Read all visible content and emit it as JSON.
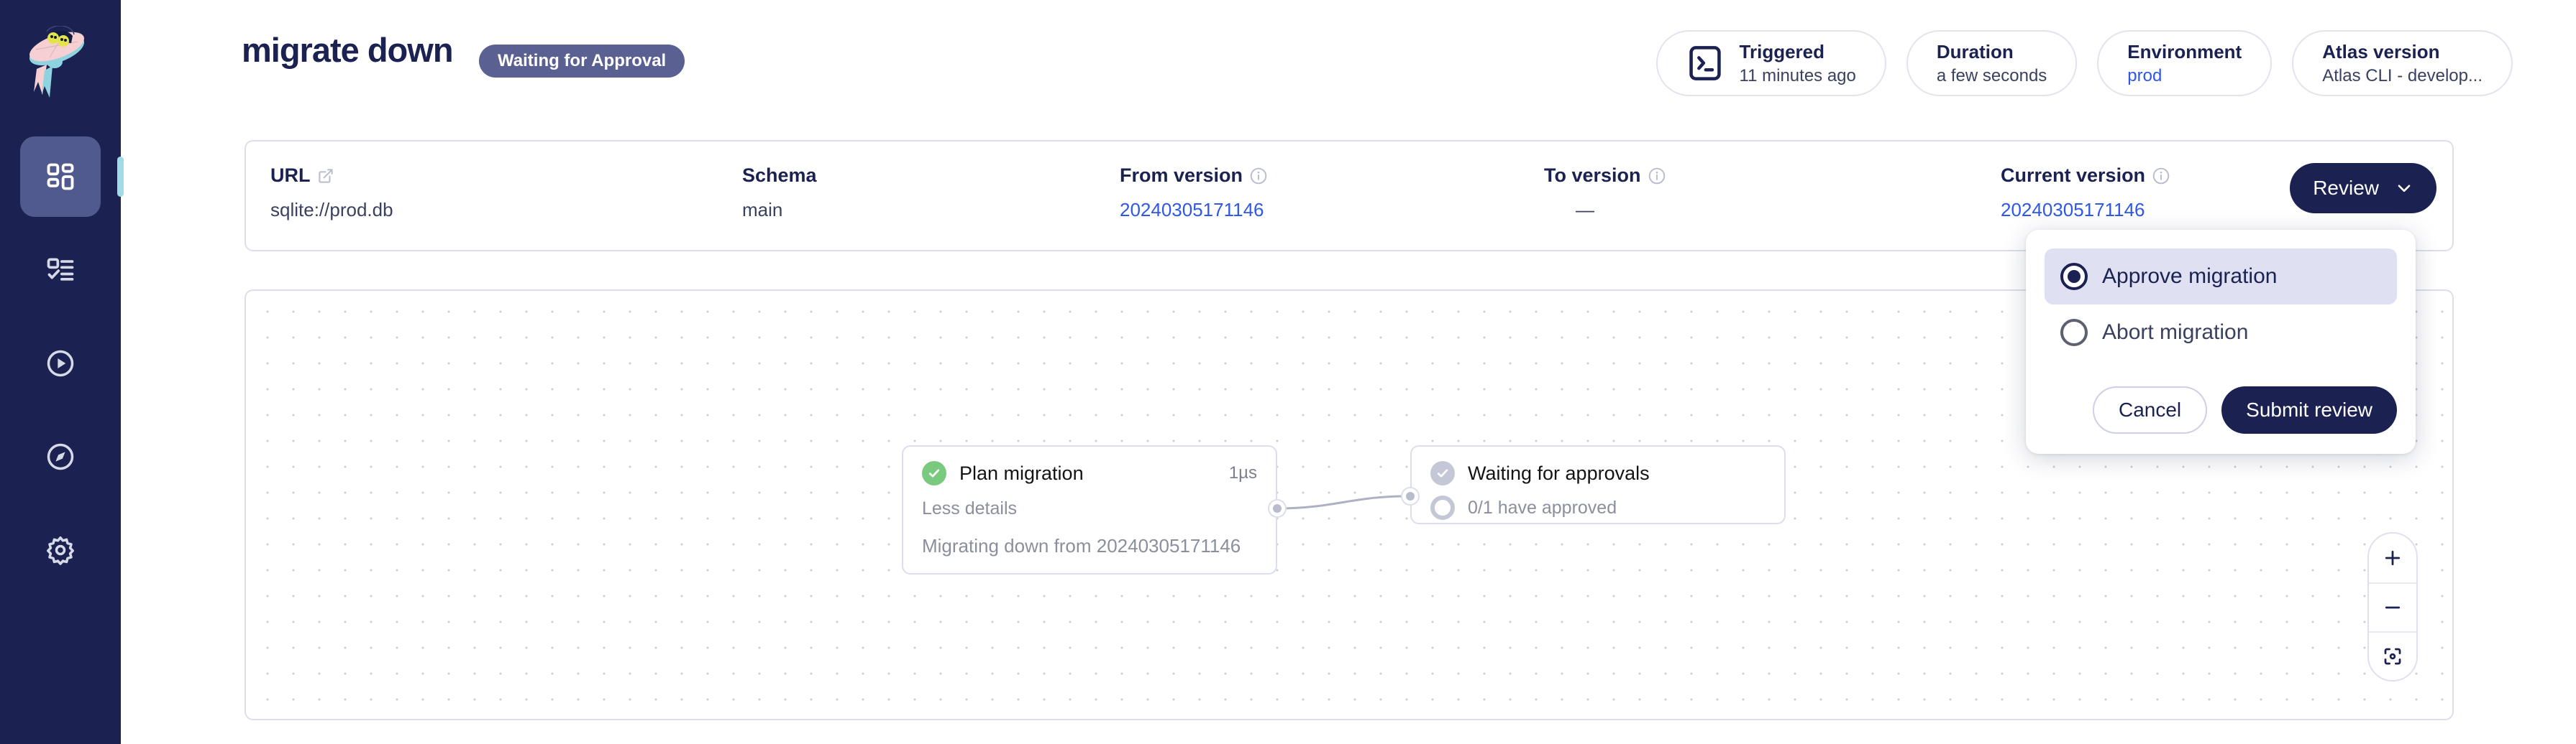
{
  "sidebar": {
    "logo": "atlas-ufo-logo",
    "items": [
      {
        "name": "dashboard",
        "icon": "grid-icon",
        "active": true
      },
      {
        "name": "tasks",
        "icon": "checklist-icon",
        "active": false
      },
      {
        "name": "runs",
        "icon": "play-circle-icon",
        "active": false
      },
      {
        "name": "explore",
        "icon": "compass-icon",
        "active": false
      },
      {
        "name": "settings",
        "icon": "gear-icon",
        "active": false
      }
    ]
  },
  "header": {
    "title": "migrate down",
    "status_badge": "Waiting for Approval",
    "badge_color": "#5a6092",
    "pills": [
      {
        "icon": "terminal-icon",
        "label": "Triggered",
        "value": "11 minutes ago",
        "is_link": false
      },
      {
        "icon": "",
        "label": "Duration",
        "value": "a few seconds",
        "is_link": false
      },
      {
        "icon": "",
        "label": "Environment",
        "value": "prod",
        "is_link": true
      },
      {
        "icon": "",
        "label": "Atlas version",
        "value": "Atlas CLI - develop...",
        "is_link": false
      }
    ]
  },
  "info_card": {
    "columns": [
      {
        "label": "URL",
        "icon": "external-link-icon",
        "value": "sqlite://prod.db",
        "is_link": false
      },
      {
        "label": "Schema",
        "icon": "",
        "value": "main",
        "is_link": false
      },
      {
        "label": "From version",
        "icon": "info-icon",
        "value": "20240305171146",
        "is_link": true
      },
      {
        "label": "To version",
        "icon": "info-icon",
        "value": "—",
        "is_link": false
      },
      {
        "label": "Current version",
        "icon": "info-icon",
        "value": "20240305171146",
        "is_link": true
      }
    ],
    "review_button": "Review"
  },
  "review_menu": {
    "options": [
      {
        "label": "Approve migration",
        "selected": true
      },
      {
        "label": "Abort migration",
        "selected": false
      }
    ],
    "cancel_label": "Cancel",
    "submit_label": "Submit review"
  },
  "flow": {
    "nodes": [
      {
        "id": "plan",
        "title": "Plan migration",
        "duration": "1µs",
        "status": "success",
        "toggle_label": "Less details",
        "detail": "Migrating down from 20240305171146"
      },
      {
        "id": "wait",
        "title": "Waiting for approvals",
        "status": "pending",
        "sub": "0/1 have approved"
      }
    ],
    "zoom_controls": {
      "zoom_in": "+",
      "zoom_out": "−",
      "fit_view": "fit-view-icon"
    }
  },
  "colors": {
    "navy": "#1b2252",
    "link_blue": "#2f57e8",
    "green": "#79c97f",
    "gray": "#c4c7d6",
    "accent_teal": "#9fdbe8",
    "menu_highlight": "#dfe1f3"
  }
}
